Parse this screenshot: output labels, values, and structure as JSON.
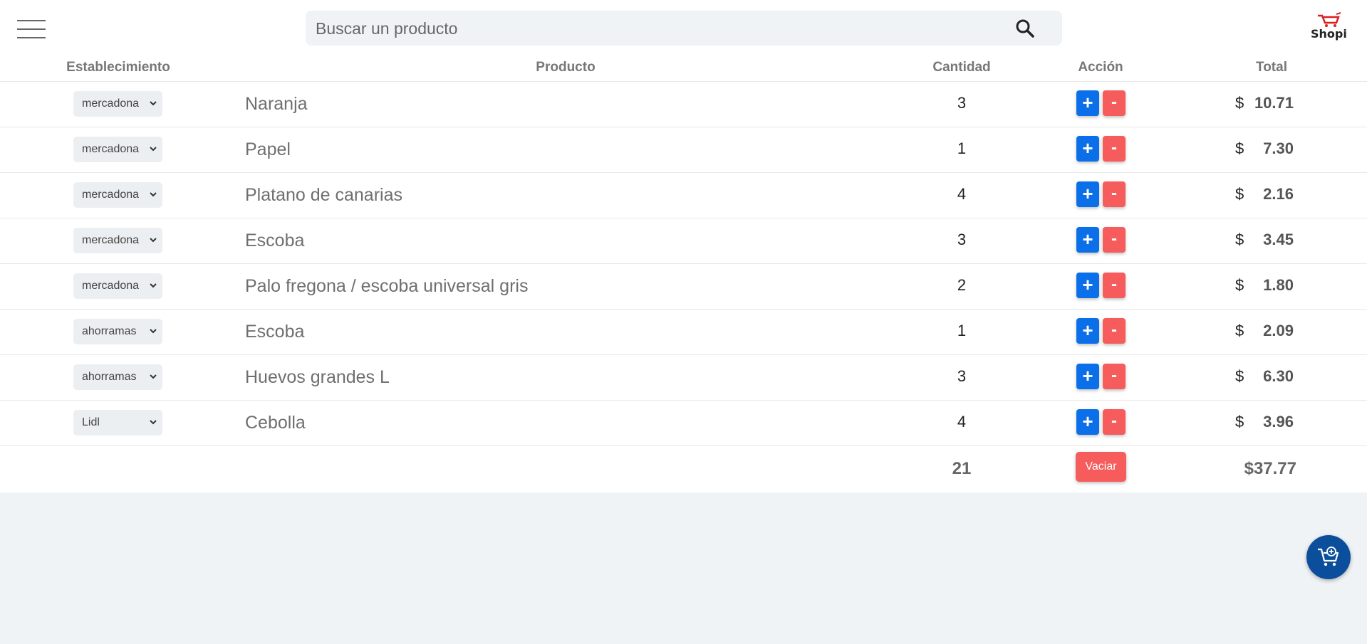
{
  "header": {
    "search_placeholder": "Buscar un producto",
    "logo_text": "Shopi"
  },
  "table": {
    "columns": [
      "Establecimiento",
      "Producto",
      "Cantidad",
      "Acción",
      "Total"
    ],
    "rows": [
      {
        "store": "mercadona",
        "product": "Naranja",
        "quantity": "3",
        "currency": "$",
        "total": "10.71"
      },
      {
        "store": "mercadona",
        "product": "Papel",
        "quantity": "1",
        "currency": "$",
        "total": "7.30"
      },
      {
        "store": "mercadona",
        "product": "Platano de canarias",
        "quantity": "4",
        "currency": "$",
        "total": "2.16"
      },
      {
        "store": "mercadona",
        "product": "Escoba",
        "quantity": "3",
        "currency": "$",
        "total": "3.45"
      },
      {
        "store": "mercadona",
        "product": "Palo fregona / escoba universal gris",
        "quantity": "2",
        "currency": "$",
        "total": "1.80"
      },
      {
        "store": "ahorramas",
        "product": "Escoba",
        "quantity": "1",
        "currency": "$",
        "total": "2.09"
      },
      {
        "store": "ahorramas",
        "product": "Huevos grandes L",
        "quantity": "3",
        "currency": "$",
        "total": "6.30"
      },
      {
        "store": "Lidl",
        "product": "Cebolla",
        "quantity": "4",
        "currency": "$",
        "total": "3.96"
      }
    ],
    "plus_label": "+",
    "minus_label": "-"
  },
  "footer": {
    "total_quantity": "21",
    "empty_label": "Vaciar",
    "grand_total": "$37.77"
  },
  "icons": {
    "menu": "hamburger-menu-icon",
    "search": "search-icon",
    "logo": "shopping-cart-logo-icon",
    "select": "chevron-down-icon",
    "fab": "cart-add-icon"
  },
  "colors": {
    "primary_blue": "#0a6fe8",
    "danger_red": "#f65c5c",
    "fab_blue": "#0b4f9c",
    "page_bg": "#f0f3f6"
  }
}
